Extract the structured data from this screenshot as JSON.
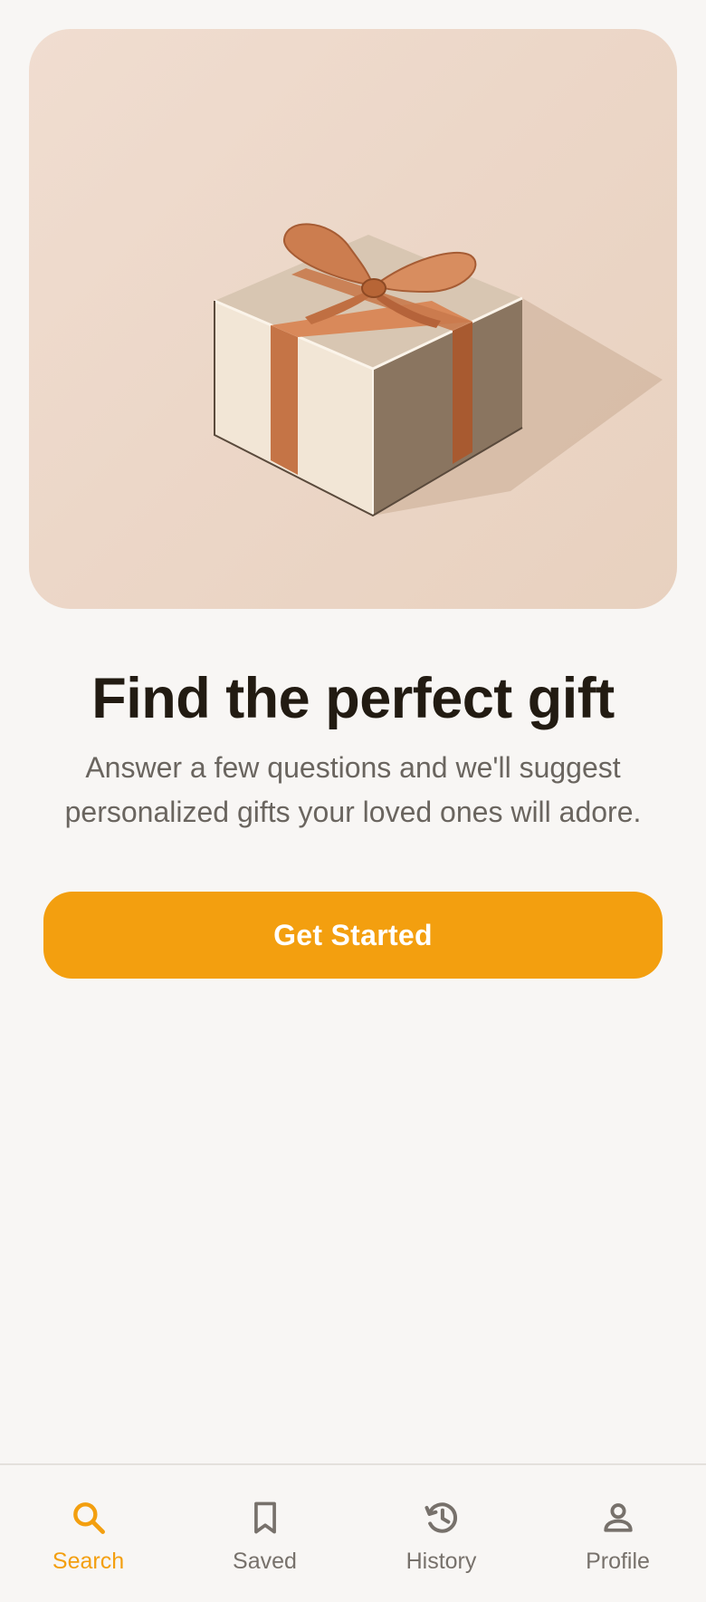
{
  "hero": {
    "image": "gift-box-illustration"
  },
  "title": "Find the perfect gift",
  "subtitle_line1": "Answer a few questions and we'll suggest",
  "subtitle_line2": "personalized gifts your loved ones will adore.",
  "cta_label": "Get Started",
  "colors": {
    "accent": "#f39f0f",
    "background": "#f8f6f4",
    "title": "#221b12",
    "muted": "#6a655f",
    "nav_inactive": "#77716b"
  },
  "nav": {
    "items": [
      {
        "label": "Search",
        "icon": "search-icon",
        "active": true
      },
      {
        "label": "Saved",
        "icon": "bookmark-icon",
        "active": false
      },
      {
        "label": "History",
        "icon": "history-icon",
        "active": false
      },
      {
        "label": "Profile",
        "icon": "person-icon",
        "active": false
      }
    ]
  }
}
